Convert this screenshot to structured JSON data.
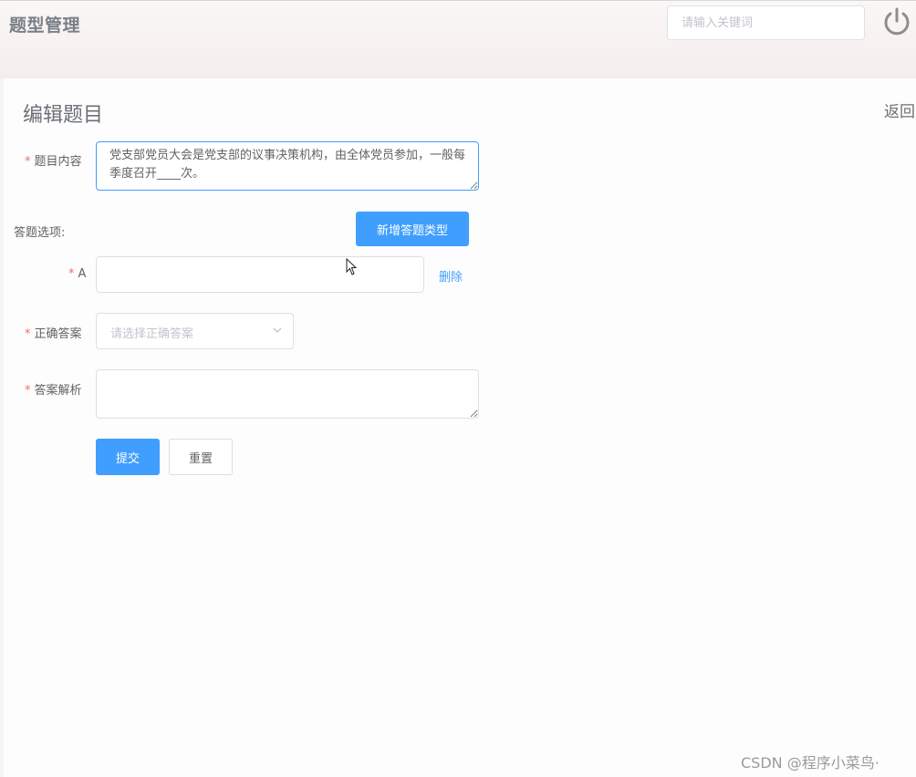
{
  "header": {
    "title": "题型管理",
    "search_placeholder": "请输入关键词",
    "power_icon": "power-icon"
  },
  "page": {
    "title": "编辑题目",
    "back_label": "返回"
  },
  "form": {
    "question_label": "题目内容",
    "question_value": "党支部党员大会是党支部的议事决策机构，由全体党员参加，一般每季度召开____次。",
    "options_label": "答题选项:",
    "add_type_button": "新增答题类型",
    "options": [
      {
        "label": "A",
        "value": "",
        "delete_label": "删除"
      }
    ],
    "correct_answer_label": "正确答案",
    "correct_answer_placeholder": "请选择正确答案",
    "analysis_label": "答案解析",
    "analysis_value": "",
    "submit_label": "提交",
    "reset_label": "重置"
  },
  "watermark": "CSDN @程序小菜鸟·",
  "colors": {
    "primary": "#409eff",
    "required": "#f56c6c",
    "text": "#606266"
  }
}
